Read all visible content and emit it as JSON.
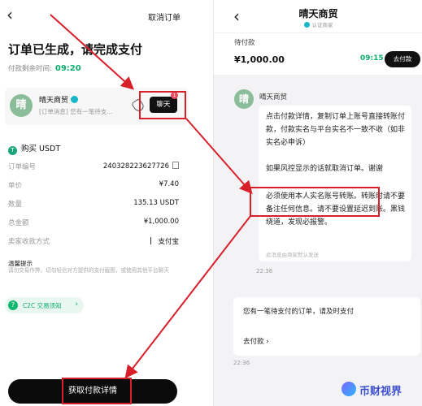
{
  "left": {
    "cancel_label": "取消订单",
    "title": "订单已生成，请完成支付",
    "time_label": "付款剩余时间:",
    "time_value": "09:20",
    "merchant": {
      "avatar": "晴",
      "name": "晴天商贸",
      "message": "[订单消息] 您有一笔待支..."
    },
    "chat_button": "聊天",
    "chat_badge": "1",
    "buy_label": "购买 USDT",
    "buy_icon": "T",
    "rows": [
      {
        "k": "订单编号",
        "v": "240328223627726"
      },
      {
        "k": "单价",
        "v": "¥7.40"
      },
      {
        "k": "数量",
        "v": "135.13 USDT"
      },
      {
        "k": "总金额",
        "v": "¥1,000.00"
      },
      {
        "k": "卖家收款方式",
        "v": "支付宝"
      }
    ],
    "tip_title": "温馨提示",
    "tip_text": "请勿交易作弊，切勿轻信对方提供的支付截图，或使用其他平台聊天",
    "c2c_label": "C2C 交易须知",
    "c2c_icon": "?",
    "main_button": "获取付款详情"
  },
  "right": {
    "title": "晴天商贸",
    "subtitle": "认证商家",
    "pay_label": "待付款",
    "amount": "¥1,000.00",
    "time": "09:15",
    "pay_button": "去付款",
    "avatar": "晴",
    "sender": "晴天商贸",
    "paragraphs": [
      "点击付款详情，复制订单上账号直接转账付款，付款实名与平台实名不一致不收（如非实名必申诉）",
      "如果风控显示的话就取消订单。谢谢",
      "必须使用本人实名账号转账。转账时请不要备注任何信息。请不要设置延迟到账。黑钱绕道，发现必报警。"
    ],
    "bubble_footer": "此消息由商家默认发送",
    "time_1": "22:36",
    "notice_text": "您有一笔待支付的订单，请及时支付",
    "notice_link": "去付款",
    "time_2": "22:36"
  },
  "watermark": "币财视界",
  "colors": {
    "accent": "#0dae6c",
    "highlight": "#d8202b",
    "button": "#0b0b0b"
  }
}
